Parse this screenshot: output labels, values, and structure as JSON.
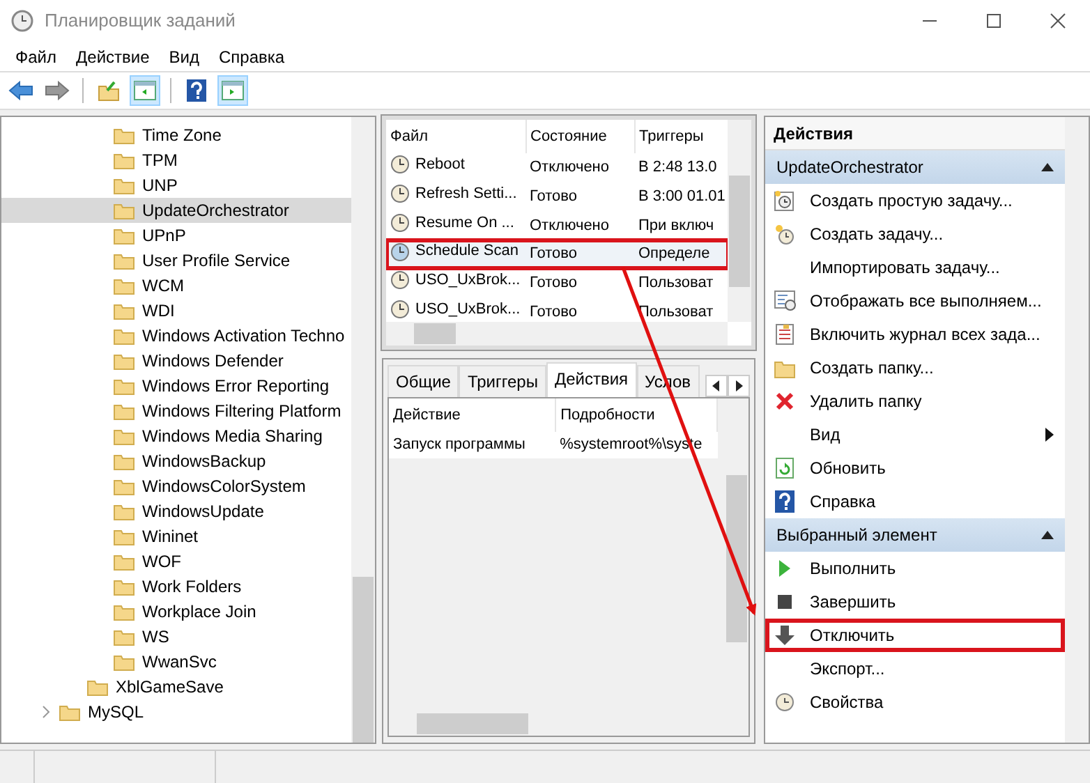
{
  "window": {
    "title": "Планировщик заданий"
  },
  "menu": [
    "Файл",
    "Действие",
    "Вид",
    "Справка"
  ],
  "tree": [
    {
      "children": [
        {
          "children": [
            {
              "label": "Time Zone",
              "selected": false
            },
            {
              "label": "TPM",
              "selected": false
            },
            {
              "label": "UNP",
              "selected": false
            },
            {
              "label": "UpdateOrchestrator",
              "selected": true
            },
            {
              "label": "UPnP",
              "selected": false
            },
            {
              "label": "User Profile Service",
              "selected": false
            },
            {
              "label": "WCM",
              "selected": false
            },
            {
              "label": "WDI",
              "selected": false
            },
            {
              "label": "Windows Activation Techno",
              "selected": false
            },
            {
              "label": "Windows Defender",
              "selected": false
            },
            {
              "label": "Windows Error Reporting",
              "selected": false
            },
            {
              "label": "Windows Filtering Platform",
              "selected": false
            },
            {
              "label": "Windows Media Sharing",
              "selected": false
            },
            {
              "label": "WindowsBackup",
              "selected": false
            },
            {
              "label": "WindowsColorSystem",
              "selected": false
            },
            {
              "label": "WindowsUpdate",
              "selected": false
            },
            {
              "label": "Wininet",
              "selected": false
            },
            {
              "label": "WOF",
              "selected": false
            },
            {
              "label": "Work Folders",
              "selected": false
            },
            {
              "label": "Workplace Join",
              "selected": false
            },
            {
              "label": "WS",
              "selected": false
            },
            {
              "label": "WwanSvc",
              "selected": false
            }
          ]
        },
        {
          "label": "XblGameSave",
          "selected": false
        }
      ]
    },
    {
      "label": "MySQL",
      "selected": false,
      "expanded": false
    }
  ],
  "tasks": {
    "columns": [
      "Файл",
      "Состояние",
      "Триггеры"
    ],
    "rows": [
      {
        "cells": [
          "Reboot",
          "Отключено",
          "В 2:48 13.0"
        ],
        "selected": false,
        "highlighted": false
      },
      {
        "cells": [
          "Refresh Setti...",
          "Готово",
          "В 3:00 01.01"
        ],
        "selected": false,
        "highlighted": false
      },
      {
        "cells": [
          "Resume On ...",
          "Отключено",
          "При включ"
        ],
        "selected": false,
        "highlighted": false
      },
      {
        "cells": [
          "Schedule Scan",
          "Готово",
          "Определе"
        ],
        "selected": true,
        "highlighted": true
      },
      {
        "cells": [
          "USO_UxBrok...",
          "Готово",
          "Пользоват"
        ],
        "selected": false,
        "highlighted": false
      },
      {
        "cells": [
          "USO_UxBrok...",
          "Готово",
          "Пользоват"
        ],
        "selected": false,
        "highlighted": false
      }
    ]
  },
  "detail_tabs": [
    {
      "label": "Общие",
      "selected": false
    },
    {
      "label": "Триггеры",
      "selected": false
    },
    {
      "label": "Действия",
      "selected": true
    },
    {
      "label": "Услов",
      "selected": false
    }
  ],
  "detail_table": {
    "columns": [
      "Действие",
      "Подробности"
    ],
    "rows": [
      [
        "Запуск программы",
        "%systemroot%\\syste"
      ]
    ]
  },
  "actions_panel": {
    "title": "Действия",
    "sections": [
      {
        "title": "UpdateOrchestrator",
        "expanded": true,
        "items": [
          {
            "label": "Создать простую задачу...",
            "submenu": false,
            "highlighted": false
          },
          {
            "label": "Создать задачу...",
            "submenu": false,
            "highlighted": false
          },
          {
            "label": "Импортировать задачу...",
            "submenu": false,
            "highlighted": false
          },
          {
            "label": "Отображать все выполняем...",
            "submenu": false,
            "highlighted": false
          },
          {
            "label": "Включить журнал всех зада...",
            "submenu": false,
            "highlighted": false
          },
          {
            "label": "Создать папку...",
            "submenu": false,
            "highlighted": false
          },
          {
            "label": "Удалить папку",
            "submenu": false,
            "highlighted": false
          },
          {
            "label": "Вид",
            "submenu": true,
            "highlighted": false
          },
          {
            "label": "Обновить",
            "submenu": false,
            "highlighted": false
          },
          {
            "label": "Справка",
            "submenu": false,
            "highlighted": false
          }
        ]
      },
      {
        "title": "Выбранный элемент",
        "expanded": true,
        "items": [
          {
            "label": "Выполнить",
            "submenu": false,
            "highlighted": false
          },
          {
            "label": "Завершить",
            "submenu": false,
            "highlighted": false
          },
          {
            "label": "Отключить",
            "submenu": false,
            "highlighted": true
          },
          {
            "label": "Экспорт...",
            "submenu": false,
            "highlighted": false
          },
          {
            "label": "Свойства",
            "submenu": false,
            "highlighted": false
          }
        ]
      }
    ]
  }
}
